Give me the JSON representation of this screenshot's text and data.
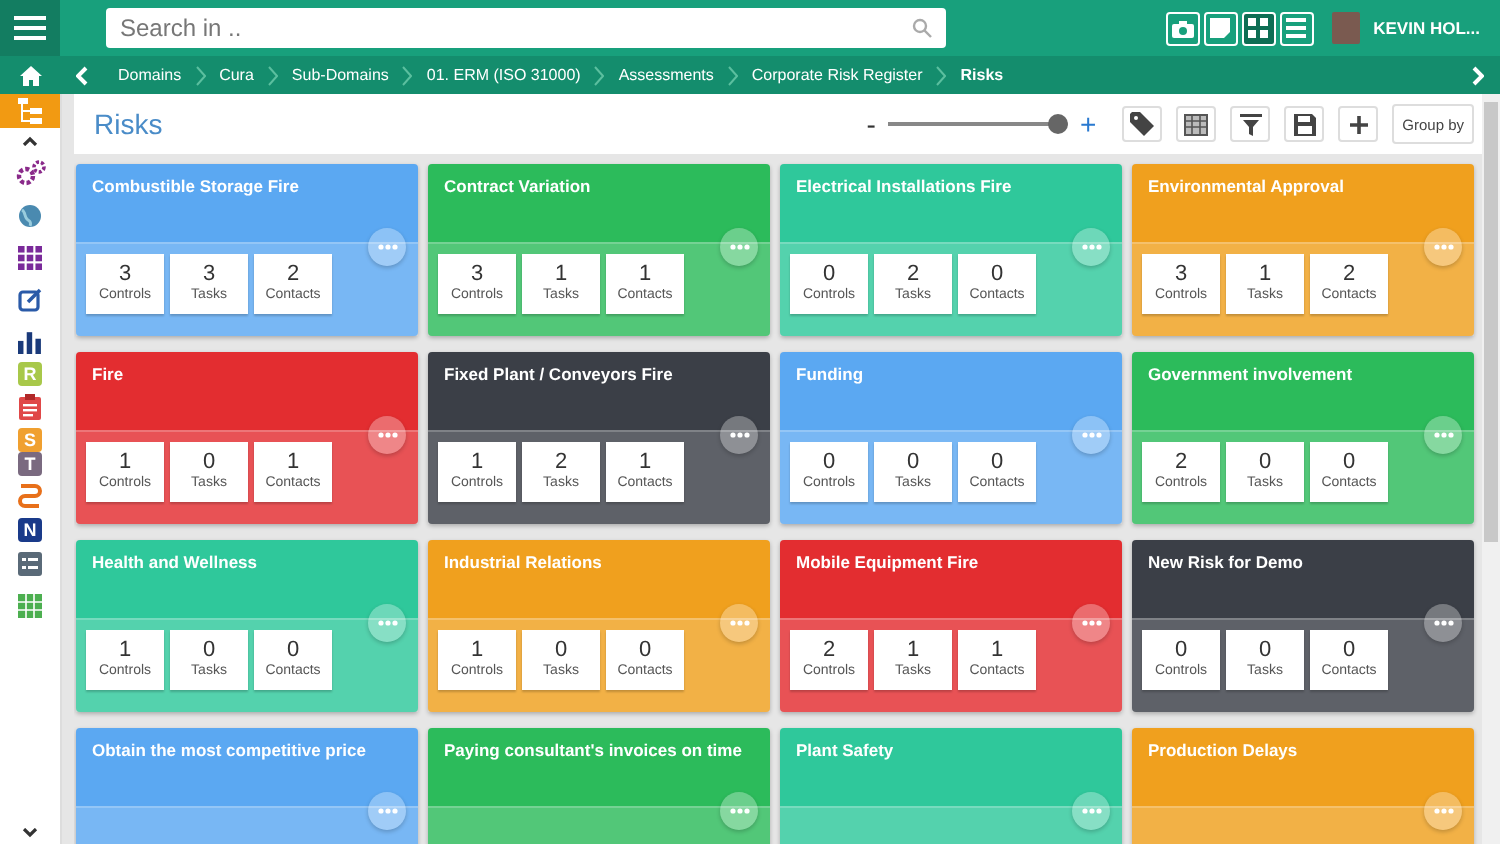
{
  "search": {
    "placeholder": "Search in .."
  },
  "view_buttons": [
    {
      "kind": "camera",
      "selected": false
    },
    {
      "kind": "note",
      "selected": false
    },
    {
      "kind": "grid",
      "selected": true
    },
    {
      "kind": "list",
      "selected": false
    }
  ],
  "user": {
    "name": "KEVIN HOL..."
  },
  "breadcrumb": [
    "Domains",
    "Cura",
    "Sub-Domains",
    "01. ERM (ISO 31000)",
    "Assessments",
    "Corporate Risk Register",
    "Risks"
  ],
  "sidebar": [
    {
      "kind": "tree",
      "selected": true
    },
    {
      "kind": "caret-up"
    },
    {
      "kind": "gears"
    },
    {
      "kind": "globe"
    },
    {
      "kind": "apps"
    },
    {
      "kind": "edit"
    },
    {
      "kind": "chart"
    },
    {
      "kind": "letter",
      "letter": "R",
      "color": "#a8c84a"
    },
    {
      "kind": "clipboard"
    },
    {
      "kind": "letter",
      "letter": "S",
      "color": "#f0a030"
    },
    {
      "kind": "letter",
      "letter": "T",
      "color": "#7a6a80"
    },
    {
      "kind": "route"
    },
    {
      "kind": "letter",
      "letter": "N",
      "color": "#1a3a8a"
    },
    {
      "kind": "list"
    },
    {
      "kind": "table"
    },
    {
      "kind": "caret-down"
    }
  ],
  "page_title": "Risks",
  "zoom": {
    "minus": "-",
    "plus": "+",
    "level": 0.95
  },
  "toolbar": [
    {
      "kind": "tag"
    },
    {
      "kind": "table"
    },
    {
      "kind": "filter"
    },
    {
      "kind": "save"
    },
    {
      "kind": "plus"
    },
    {
      "kind": "text",
      "label": "Group by"
    }
  ],
  "cards": [
    {
      "title": "Combustible Storage Fire",
      "color": "#5ba8f2",
      "counts": [
        {
          "value": "3",
          "label": "Controls"
        },
        {
          "value": "3",
          "label": "Tasks"
        },
        {
          "value": "2",
          "label": "Contacts"
        }
      ]
    },
    {
      "title": "Contract Variation",
      "color": "#2cbb5b",
      "counts": [
        {
          "value": "3",
          "label": "Controls"
        },
        {
          "value": "1",
          "label": "Tasks"
        },
        {
          "value": "1",
          "label": "Contacts"
        }
      ]
    },
    {
      "title": "Electrical Installations Fire",
      "color": "#2fc89b",
      "counts": [
        {
          "value": "0",
          "label": "Controls"
        },
        {
          "value": "2",
          "label": "Tasks"
        },
        {
          "value": "0",
          "label": "Contacts"
        }
      ]
    },
    {
      "title": "Environmental Approval",
      "color": "#f0a01e",
      "counts": [
        {
          "value": "3",
          "label": "Controls"
        },
        {
          "value": "1",
          "label": "Tasks"
        },
        {
          "value": "2",
          "label": "Contacts"
        }
      ]
    },
    {
      "title": "Fire",
      "color": "#e32d30",
      "counts": [
        {
          "value": "1",
          "label": "Controls"
        },
        {
          "value": "0",
          "label": "Tasks"
        },
        {
          "value": "1",
          "label": "Contacts"
        }
      ]
    },
    {
      "title": "Fixed Plant / Conveyors Fire",
      "color": "#3b3f47",
      "counts": [
        {
          "value": "1",
          "label": "Controls"
        },
        {
          "value": "2",
          "label": "Tasks"
        },
        {
          "value": "1",
          "label": "Contacts"
        }
      ]
    },
    {
      "title": "Funding",
      "color": "#5ba8f2",
      "counts": [
        {
          "value": "0",
          "label": "Controls"
        },
        {
          "value": "0",
          "label": "Tasks"
        },
        {
          "value": "0",
          "label": "Contacts"
        }
      ]
    },
    {
      "title": "Government involvement",
      "color": "#2cbb5b",
      "counts": [
        {
          "value": "2",
          "label": "Controls"
        },
        {
          "value": "0",
          "label": "Tasks"
        },
        {
          "value": "0",
          "label": "Contacts"
        }
      ]
    },
    {
      "title": "Health and Wellness",
      "color": "#2fc89b",
      "counts": [
        {
          "value": "1",
          "label": "Controls"
        },
        {
          "value": "0",
          "label": "Tasks"
        },
        {
          "value": "0",
          "label": "Contacts"
        }
      ]
    },
    {
      "title": "Industrial Relations",
      "color": "#f0a01e",
      "counts": [
        {
          "value": "1",
          "label": "Controls"
        },
        {
          "value": "0",
          "label": "Tasks"
        },
        {
          "value": "0",
          "label": "Contacts"
        }
      ]
    },
    {
      "title": "Mobile Equipment Fire",
      "color": "#e32d30",
      "counts": [
        {
          "value": "2",
          "label": "Controls"
        },
        {
          "value": "1",
          "label": "Tasks"
        },
        {
          "value": "1",
          "label": "Contacts"
        }
      ]
    },
    {
      "title": "New Risk for Demo",
      "color": "#3b3f47",
      "counts": [
        {
          "value": "0",
          "label": "Controls"
        },
        {
          "value": "0",
          "label": "Tasks"
        },
        {
          "value": "0",
          "label": "Contacts"
        }
      ]
    },
    {
      "title": "Obtain the most competitive price",
      "color": "#5ba8f2"
    },
    {
      "title": "Paying consultant's invoices on time",
      "color": "#2cbb5b"
    },
    {
      "title": "Plant Safety",
      "color": "#2fc89b"
    },
    {
      "title": "Production Delays",
      "color": "#f0a01e"
    }
  ]
}
